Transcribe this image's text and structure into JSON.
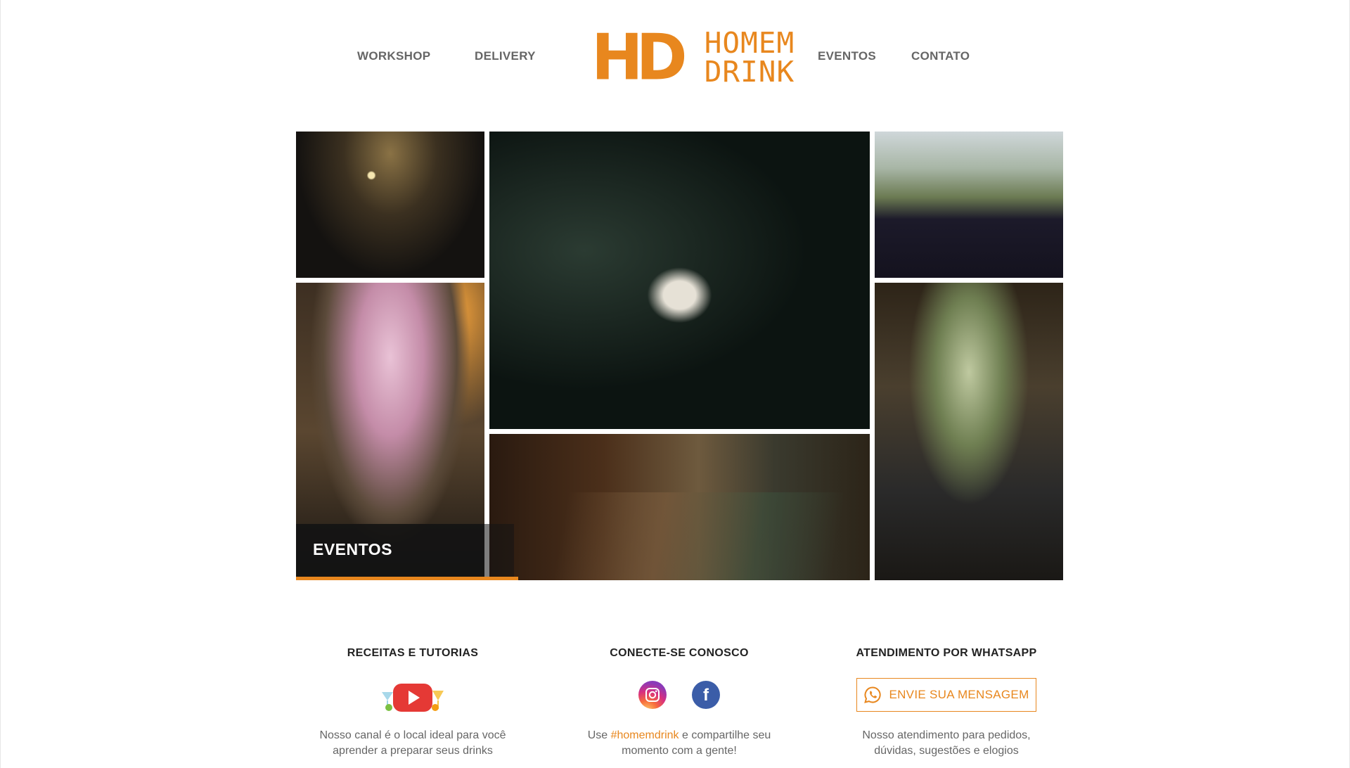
{
  "nav": {
    "left": [
      {
        "label": "WORKSHOP"
      },
      {
        "label": "DELIVERY"
      }
    ],
    "right": [
      {
        "label": "EVENTOS"
      },
      {
        "label": "CONTATO"
      }
    ]
  },
  "logo": {
    "mark": "HD",
    "line1": "HOMEM",
    "line2": "DRINK",
    "color": "#e8871e"
  },
  "gallery": {
    "caption": "EVENTOS",
    "progress": 0.29
  },
  "footer": {
    "youtube": {
      "title": "RECEITAS E TUTORIAS",
      "text_line1": "Nosso canal é o local ideal para você",
      "text_line2": "aprender a preparar seus drinks",
      "icon": "youtube-drinks-icon"
    },
    "social": {
      "title": "CONECTE-SE CONOSCO",
      "text_prefix": "Use ",
      "hashtag": "#homemdrink",
      "text_suffix": " e compartilhe seu",
      "text_line2": "momento com a gente!",
      "icons": [
        "instagram-icon",
        "facebook-icon"
      ]
    },
    "whatsapp": {
      "title": "ATENDIMENTO POR WHATSAPP",
      "button_label": "ENVIE SUA MENSAGEM",
      "text_line1": "Nosso atendimento para pedidos,",
      "text_line2": "dúvidas, sugestões e elogios",
      "icon": "whatsapp-icon"
    }
  },
  "colors": {
    "accent": "#e8871e",
    "nav_text": "#666666",
    "heading": "#222222"
  }
}
